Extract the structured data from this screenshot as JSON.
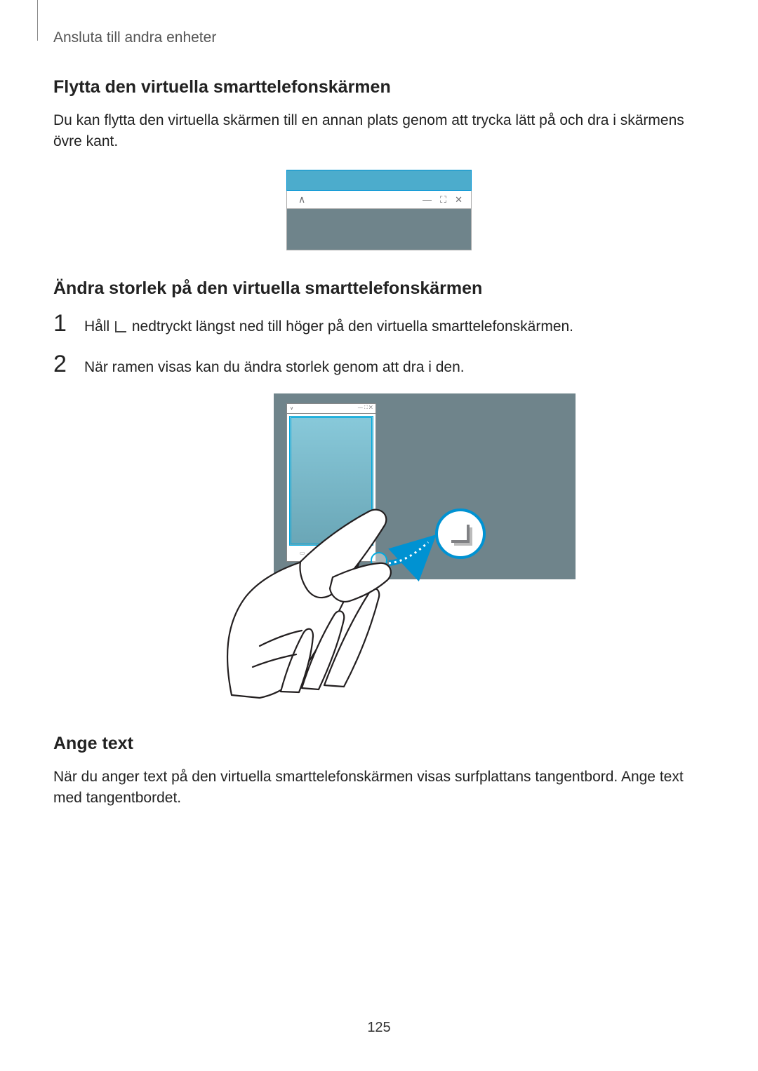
{
  "header": "Ansluta till andra enheter",
  "section1": {
    "title": "Flytta den virtuella smarttelefonskärmen",
    "text": "Du kan flytta den virtuella skärmen till en annan plats genom att trycka lätt på och dra i skärmens övre kant."
  },
  "section2": {
    "title": "Ändra storlek på den virtuella smarttelefonskärmen",
    "step1_a": "Håll ",
    "step1_b": " nedtryckt längst ned till höger på den virtuella smarttelefonskärmen.",
    "step2": "När ramen visas kan du ändra storlek genom att dra i den."
  },
  "section3": {
    "title": "Ange text",
    "text": "När du anger text på den virtuella smarttelefonskärmen visas surfplattans tangentbord. Ange text med tangentbordet."
  },
  "page_number": "125",
  "fig1_controls": {
    "caret": "∧",
    "minimize": "—",
    "maximize": "⛶",
    "close": "✕"
  }
}
